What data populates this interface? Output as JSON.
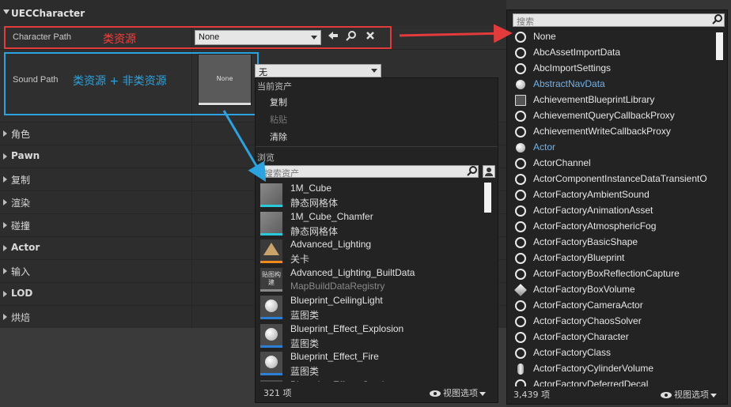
{
  "details": {
    "category_title": "UECCharacter",
    "props": {
      "character_path": {
        "label": "Character Path",
        "value": "None"
      },
      "sound_path": {
        "label": "Sound Path",
        "thumb_text": "None"
      }
    },
    "categories": [
      "角色",
      "Pawn",
      "复制",
      "渲染",
      "碰撞",
      "Actor",
      "输入",
      "LOD",
      "烘焙"
    ]
  },
  "annotations": {
    "red_label": "类资源",
    "blue_label": "类资源 + 非类资源",
    "red_color": "#e33b3b",
    "blue_color": "#2aa3e0"
  },
  "asset_picker": {
    "combo_value": "无",
    "current_asset_title": "当前资产",
    "menu": [
      "复制",
      "粘贴",
      "清除"
    ],
    "browse_title": "浏览",
    "search_placeholder": "搜索资产",
    "assets": [
      {
        "name": "1M_Cube",
        "type": "静态网格体",
        "thumb": "cube"
      },
      {
        "name": "1M_Cube_Chamfer",
        "type": "静态网格体",
        "thumb": "cube"
      },
      {
        "name": "Advanced_Lighting",
        "type": "关卡",
        "thumb": "lvl"
      },
      {
        "name": "Advanced_Lighting_BuiltData",
        "type": "MapBuildDataRegistry",
        "thumb": "build",
        "thumb_text": "贴图构建"
      },
      {
        "name": "Blueprint_CeilingLight",
        "type": "蓝图类",
        "thumb": "bp"
      },
      {
        "name": "Blueprint_Effect_Explosion",
        "type": "蓝图类",
        "thumb": "bp"
      },
      {
        "name": "Blueprint_Effect_Fire",
        "type": "蓝图类",
        "thumb": "bp"
      },
      {
        "name": "Blueprint_Effect_Smoke",
        "type": "",
        "thumb": "bp"
      }
    ],
    "count": "321 项",
    "view_options": "视图选项"
  },
  "class_picker": {
    "search_placeholder": "搜索",
    "classes": [
      {
        "name": "None",
        "icon": "ring"
      },
      {
        "name": "AbcAssetImportData",
        "icon": "ring"
      },
      {
        "name": "AbcImportSettings",
        "icon": "ring"
      },
      {
        "name": "AbstractNavData",
        "icon": "filled",
        "blue": true
      },
      {
        "name": "AchievementBlueprintLibrary",
        "icon": "book"
      },
      {
        "name": "AchievementQueryCallbackProxy",
        "icon": "ring"
      },
      {
        "name": "AchievementWriteCallbackProxy",
        "icon": "ring"
      },
      {
        "name": "Actor",
        "icon": "filled",
        "blue": true
      },
      {
        "name": "ActorChannel",
        "icon": "ring"
      },
      {
        "name": "ActorComponentInstanceDataTransientO",
        "icon": "ring"
      },
      {
        "name": "ActorFactoryAmbientSound",
        "icon": "ring"
      },
      {
        "name": "ActorFactoryAnimationAsset",
        "icon": "ring"
      },
      {
        "name": "ActorFactoryAtmosphericFog",
        "icon": "ring"
      },
      {
        "name": "ActorFactoryBasicShape",
        "icon": "ring"
      },
      {
        "name": "ActorFactoryBlueprint",
        "icon": "ring"
      },
      {
        "name": "ActorFactoryBoxReflectionCapture",
        "icon": "ring"
      },
      {
        "name": "ActorFactoryBoxVolume",
        "icon": "cube"
      },
      {
        "name": "ActorFactoryCameraActor",
        "icon": "ring"
      },
      {
        "name": "ActorFactoryChaosSolver",
        "icon": "ring"
      },
      {
        "name": "ActorFactoryCharacter",
        "icon": "ring"
      },
      {
        "name": "ActorFactoryClass",
        "icon": "ring"
      },
      {
        "name": "ActorFactoryCylinderVolume",
        "icon": "cyl"
      },
      {
        "name": "ActorFactoryDeferredDecal",
        "icon": "ring"
      }
    ],
    "count": "3,439 项",
    "view_options": "视图选项"
  }
}
